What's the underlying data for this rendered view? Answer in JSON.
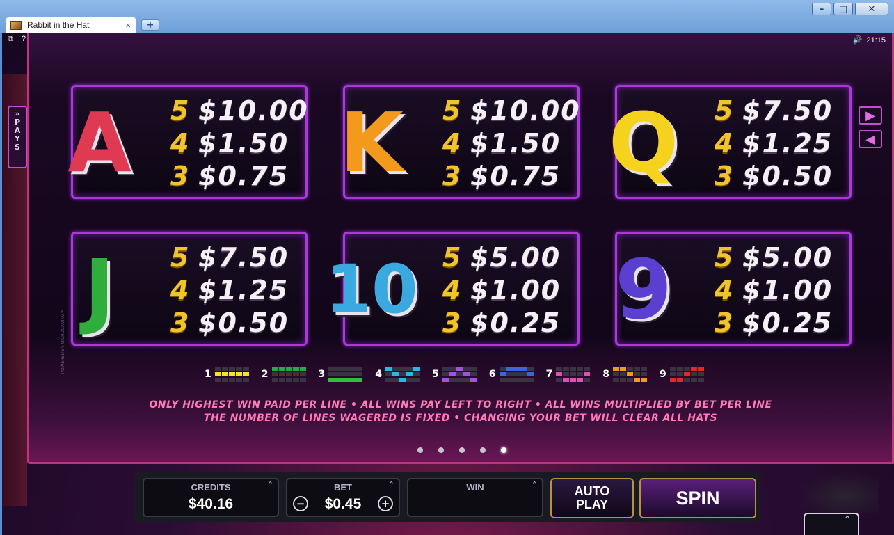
{
  "window": {
    "tab_title": "Rabbit in the Hat",
    "minimize": "–",
    "maximize": "□",
    "close": "✕",
    "newtab": "+"
  },
  "game": {
    "top_icons": [
      "⧉",
      "?"
    ],
    "clock": "21:15",
    "pays_tab": {
      "chevrons": "»",
      "letters": [
        "P",
        "A",
        "Y",
        "S"
      ]
    },
    "cards": [
      {
        "symbol": "A",
        "color": "#e03a52",
        "rows": [
          {
            "n": "5",
            "v": "$10.00"
          },
          {
            "n": "4",
            "v": "$1.50"
          },
          {
            "n": "3",
            "v": "$0.75"
          }
        ]
      },
      {
        "symbol": "K",
        "color": "#f39a1c",
        "rows": [
          {
            "n": "5",
            "v": "$10.00"
          },
          {
            "n": "4",
            "v": "$1.50"
          },
          {
            "n": "3",
            "v": "$0.75"
          }
        ]
      },
      {
        "symbol": "Q",
        "color": "#f5d21e",
        "rows": [
          {
            "n": "5",
            "v": "$7.50"
          },
          {
            "n": "4",
            "v": "$1.25"
          },
          {
            "n": "3",
            "v": "$0.50"
          }
        ]
      },
      {
        "symbol": "J",
        "color": "#2fae3e",
        "rows": [
          {
            "n": "5",
            "v": "$7.50"
          },
          {
            "n": "4",
            "v": "$1.25"
          },
          {
            "n": "3",
            "v": "$0.50"
          }
        ]
      },
      {
        "symbol": "10",
        "color": "#39a9e0",
        "rows": [
          {
            "n": "5",
            "v": "$5.00"
          },
          {
            "n": "4",
            "v": "$1.00"
          },
          {
            "n": "3",
            "v": "$0.25"
          }
        ]
      },
      {
        "symbol": "9",
        "color": "#5b3fd0",
        "rows": [
          {
            "n": "5",
            "v": "$5.00"
          },
          {
            "n": "4",
            "v": "$1.00"
          },
          {
            "n": "3",
            "v": "$0.25"
          }
        ]
      }
    ],
    "lines": [
      {
        "num": "1",
        "color": "#f5e51a",
        "cells": [
          0,
          0,
          0,
          0,
          0,
          1,
          1,
          1,
          1,
          1,
          0,
          0,
          0,
          0,
          0
        ]
      },
      {
        "num": "2",
        "color": "#1fae47",
        "cells": [
          1,
          1,
          1,
          1,
          1,
          0,
          0,
          0,
          0,
          0,
          0,
          0,
          0,
          0,
          0
        ]
      },
      {
        "num": "3",
        "color": "#2fbf3a",
        "cells": [
          0,
          0,
          0,
          0,
          0,
          0,
          0,
          0,
          0,
          0,
          1,
          1,
          1,
          1,
          1
        ]
      },
      {
        "num": "4",
        "color": "#27b9e6",
        "cells": [
          1,
          0,
          0,
          0,
          1,
          0,
          1,
          0,
          1,
          0,
          0,
          0,
          1,
          0,
          0
        ]
      },
      {
        "num": "5",
        "color": "#a054d6",
        "cells": [
          0,
          0,
          1,
          0,
          0,
          0,
          1,
          0,
          1,
          0,
          1,
          0,
          0,
          0,
          1
        ]
      },
      {
        "num": "6",
        "color": "#3f63dc",
        "cells": [
          0,
          1,
          1,
          1,
          0,
          1,
          0,
          0,
          0,
          1,
          0,
          0,
          0,
          0,
          0
        ]
      },
      {
        "num": "7",
        "color": "#e04fb6",
        "cells": [
          0,
          0,
          0,
          0,
          0,
          1,
          0,
          0,
          0,
          1,
          0,
          1,
          1,
          1,
          0
        ]
      },
      {
        "num": "8",
        "color": "#f09a23",
        "cells": [
          1,
          1,
          0,
          0,
          0,
          0,
          0,
          1,
          0,
          0,
          0,
          0,
          0,
          1,
          1
        ]
      },
      {
        "num": "9",
        "color": "#e42828",
        "cells": [
          0,
          0,
          0,
          1,
          1,
          0,
          0,
          1,
          0,
          0,
          1,
          1,
          0,
          0,
          0
        ]
      }
    ],
    "rules_line1": "ONLY HIGHEST WIN PAID PER LINE • ALL WINS PAY LEFT TO RIGHT • ALL WINS MULTIPLIED BY BET PER LINE",
    "rules_line2": "THE NUMBER OF LINES WAGERED IS FIXED • CHANGING YOUR BET WILL CLEAR ALL HATS",
    "page_dots": 5,
    "active_dot": 5,
    "powered_by": "POWERED BY MICROGAMING™",
    "nav_next": "▶",
    "nav_prev": "◀"
  },
  "controls": {
    "credits_label": "CREDITS",
    "credits_value": "$40.16",
    "bet_label": "BET",
    "bet_value": "$0.45",
    "bet_minus": "−",
    "bet_plus": "+",
    "win_label": "WIN",
    "win_value": "",
    "chevron": "⌃",
    "autoplay_line1": "AUTO",
    "autoplay_line2": "PLAY",
    "spin_label": "SPIN",
    "corner_chevron": "⌃"
  }
}
